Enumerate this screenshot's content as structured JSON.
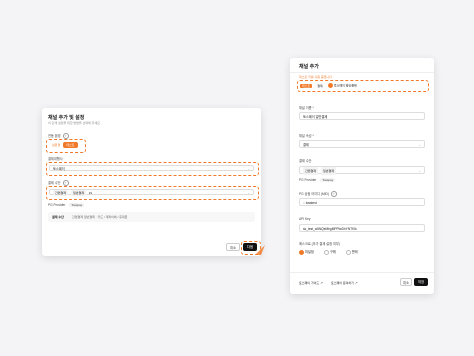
{
  "left": {
    "title": "채널 추가 및 설정",
    "subtitle": "이 단계 설정을 위한 방법을 선택해 주세요",
    "env_label": "연동 환경",
    "env_options": [
      "실환경",
      "테스트"
    ],
    "env_help": "?",
    "pg_label": "결제대행사",
    "pg_value": "토스페이",
    "method_label": "결제 수단",
    "method_help": "?",
    "method_chips": [
      "간편결제",
      "일반결제"
    ],
    "method_count": "#1",
    "pg_provider_label": "PG Provider",
    "pg_provider_value": "Tosspay",
    "table_key": "결제 수단",
    "table_value": "간편결제 일반결제 · 카드 / 계좌이체 / 휴대폰",
    "cancel": "취소",
    "next": "다음"
  },
  "right": {
    "title": "채널 추가",
    "notice": "테스트 키를 사용 중입니다",
    "env_options": [
      "테스트",
      "결제",
      "토스페이 일반결제"
    ],
    "channel_name_label": "채널 이름 *",
    "channel_name_value": "토스페이 일반결제",
    "channel_attr_label": "채널 속성 *",
    "channel_attr_value": "결제",
    "method_label": "결제 수단",
    "method_chips": [
      "간편결제",
      "일반결제"
    ],
    "pg_provider_label": "PG Provider",
    "pg_provider_value": "Tosspay",
    "mid_label": "PG 상점 아이디 (MID)",
    "mid_value": "tosstest",
    "api_key_label": "API Key",
    "api_key_value": "sk_test_w5NQeMbgMPPlwDhYNTfXk",
    "approval_label": "에스크로 (추가 결제 설정 여부)",
    "approval_options": [
      "미설정",
      "구매",
      "판매"
    ],
    "footer_links": [
      "토스페이 가이드",
      "토스페이 문의하기"
    ],
    "cancel": "취소",
    "save": "저장"
  }
}
